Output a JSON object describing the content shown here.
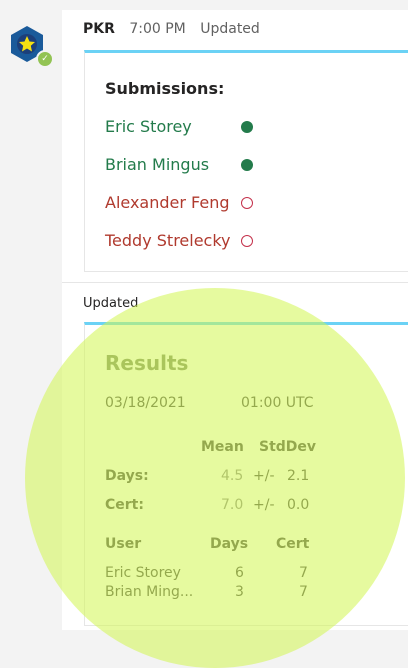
{
  "header": {
    "sender": "PKR",
    "time": "7:00 PM",
    "status": "Updated"
  },
  "submissions": {
    "title": "Submissions:",
    "items": [
      {
        "name": "Eric Storey",
        "state": "done"
      },
      {
        "name": "Brian Mingus",
        "state": "done"
      },
      {
        "name": "Alexander Feng",
        "state": "pending"
      },
      {
        "name": "Teddy Strelecky",
        "state": "pending"
      }
    ]
  },
  "update_label": "Updated",
  "results": {
    "title": "Results",
    "date": "03/18/2021",
    "time": "01:00 UTC",
    "col_mean": "Mean",
    "col_stddev": "StdDev",
    "days": {
      "label": "Days:",
      "mean": "4.5",
      "pm": "+/-",
      "stddev": "2.1"
    },
    "cert": {
      "label": "Cert:",
      "mean": "7.0",
      "pm": "+/-",
      "stddev": "0.0"
    },
    "table": {
      "headers": [
        "User",
        "Days",
        "Cert"
      ],
      "rows": [
        [
          "Eric Storey",
          "6",
          "7"
        ],
        [
          "Brian Ming...",
          "3",
          "7"
        ]
      ]
    }
  },
  "colors": {
    "accent": "#6bd2f5",
    "done": "#237b4b",
    "pending": "#b03a2e",
    "highlight": "#d2f550"
  }
}
